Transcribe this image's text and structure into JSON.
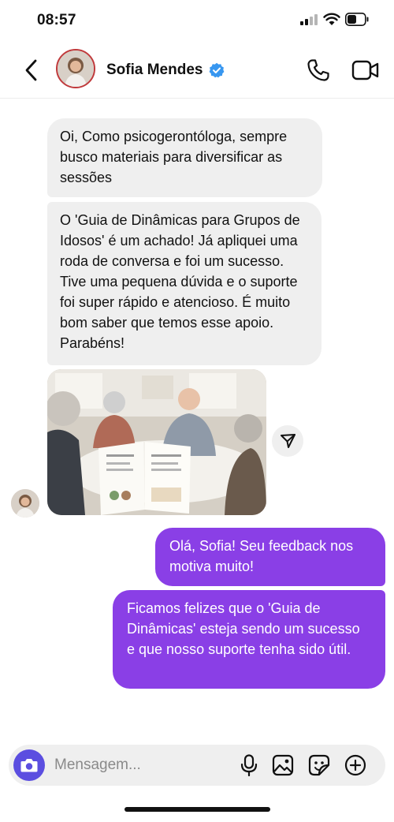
{
  "status_bar": {
    "time": "08:57"
  },
  "header": {
    "contact_name": "Sofia Mendes"
  },
  "messages": {
    "incoming": [
      "Oi, Como psicogerontóloga, sempre busco materiais para diversificar as sessões",
      "O 'Guia de Dinâmicas para Grupos de Idosos' é um achado! Já apliquei uma roda de conversa e foi um sucesso. Tive uma pequena dúvida e o suporte foi super rápido e atencioso. É muito bom saber que temos esse apoio. Parabéns!"
    ],
    "outgoing": [
      "Olá, Sofia! Seu feedback nos motiva muito!",
      "Ficamos felizes que o 'Guia de Dinâmicas' esteja sendo um sucesso e que nosso suporte tenha sido útil."
    ]
  },
  "composer": {
    "placeholder": "Mensagem..."
  },
  "colors": {
    "outgoing_bubble": "#8a3fe6",
    "incoming_bubble": "#efefef",
    "camera_button": "#5b4ee0",
    "verified": "#3897f0"
  },
  "icons": [
    "signal-icon",
    "wifi-icon",
    "battery-icon",
    "back-arrow-icon",
    "verified-badge-icon",
    "phone-icon",
    "video-camera-icon",
    "send-icon",
    "camera-icon",
    "microphone-icon",
    "gallery-icon",
    "sticker-icon",
    "plus-icon"
  ]
}
